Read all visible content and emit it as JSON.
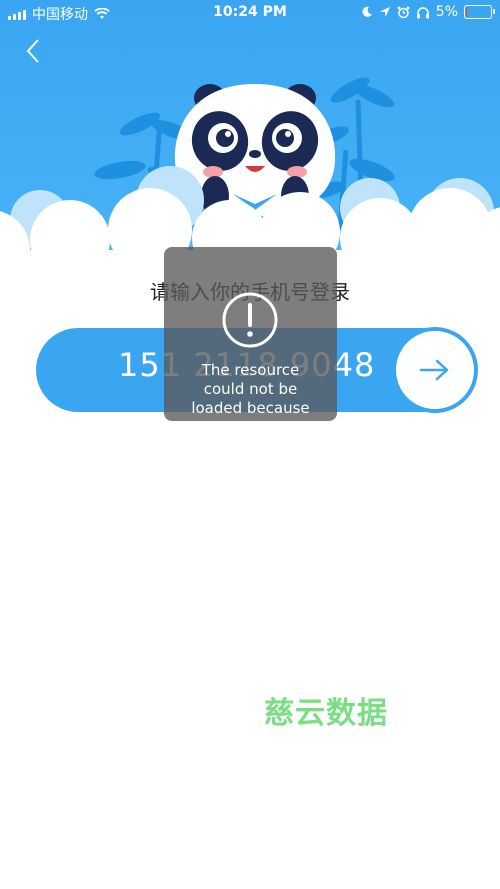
{
  "status_bar": {
    "carrier": "中国移动",
    "time": "10:24 PM",
    "battery_percent": "5%",
    "battery_level": 0.05,
    "icons": [
      "signal-icon",
      "wifi-icon",
      "moon-icon",
      "location-icon",
      "alarm-icon",
      "headphones-icon",
      "battery-icon"
    ]
  },
  "header": {
    "back_icon": "chevron-left-icon"
  },
  "login": {
    "prompt": "请输入你的手机号登录",
    "phone_number": "151 2118 9048",
    "next_icon": "arrow-right-icon"
  },
  "error_overlay": {
    "icon": "exclamation-circle-icon",
    "message_lines": [
      "The resource",
      "could not be",
      "loaded because"
    ]
  },
  "watermark": "慈云数据",
  "colors": {
    "primary": "#3aa6f2",
    "battery_low": "#ff3b30",
    "watermark": "#6ddb77"
  }
}
